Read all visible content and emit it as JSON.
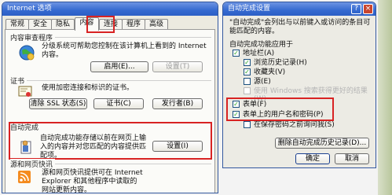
{
  "left_window": {
    "title": "Internet 选项",
    "tabs": [
      "常规",
      "安全",
      "隐私",
      "内容",
      "连接",
      "程序",
      "高级"
    ],
    "content_advisor": {
      "heading": "内容审查程序",
      "description": "分级系统可帮助您控制在该计算机上看到的 Internet 内容。",
      "enable_button": "启用(E)...",
      "settings_button": "设置(T)"
    },
    "certificates": {
      "heading": "证书",
      "description": "使用加密连接和标识的证书。",
      "clear_ssl_button": "清除 SSL 状态(S)",
      "certificates_button": "证书(C)",
      "publishers_button": "发行者(B)"
    },
    "autocomplete": {
      "heading": "自动完成",
      "description": "自动完成功能存储以前在网页上输入的内容并对您匹配的内容提供匹配项。",
      "settings_button": "设置(I)"
    },
    "feeds": {
      "heading": "源和网页快讯",
      "description": "源和网页快讯提供可在 Internet Explorer 和其他程序中读取的网站更新内容。"
    }
  },
  "right_window": {
    "title": "自动完成设置",
    "help_glyph": "?",
    "close_glyph": "×",
    "description": "\"自动完成\"会列出与以前键入或访问的条目可能匹配的内容。",
    "group_heading": "自动完成功能应用于",
    "options": [
      {
        "label": "地址栏(A)",
        "checked": true,
        "faded": false
      },
      {
        "label": "浏览历史记录(H)",
        "checked": true,
        "faded": false
      },
      {
        "label": "收藏夹(V)",
        "checked": true,
        "faded": false
      },
      {
        "label": "源(E)",
        "checked": false,
        "faded": false
      },
      {
        "label": "使用 Windows 搜索获得更好的结果(W)",
        "checked": false,
        "faded": true
      },
      {
        "label": "表单(F)",
        "checked": true,
        "faded": false
      },
      {
        "label": "表单上的用户名和密码(P)",
        "checked": true,
        "faded": false
      },
      {
        "label": "在保存密码之前询问我(S)",
        "checked": false,
        "faded": false
      }
    ],
    "delete_history_button": "删除自动完成历史记录(D)...",
    "ok_button": "确定",
    "cancel_button": "取消"
  },
  "colors": {
    "title_bar": "#3469d0",
    "highlight_box": "#d82323",
    "checkbox_tick": "#21a121"
  }
}
